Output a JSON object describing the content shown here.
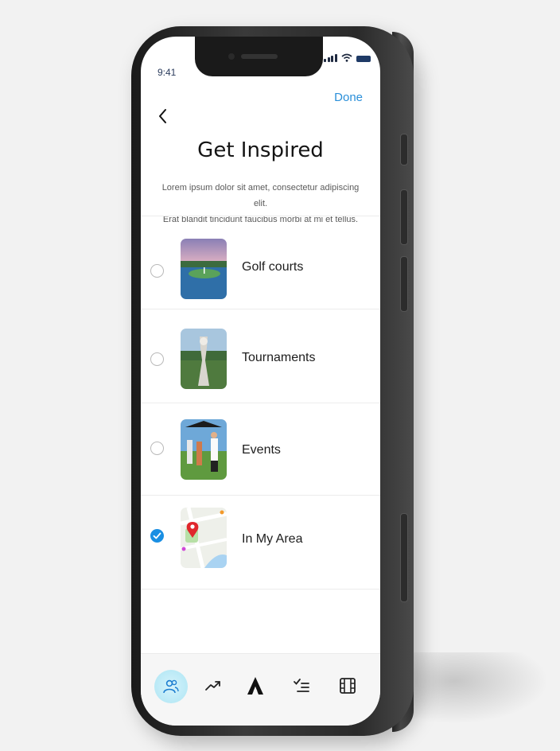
{
  "status": {
    "time": "9:41"
  },
  "header": {
    "done_label": "Done",
    "back_icon": "chevron-left-icon"
  },
  "page": {
    "title": "Get Inspired",
    "description_line1": "Lorem ipsum dolor sit amet, consectetur adipiscing elit.",
    "description_line2": "Erat blandit tincidunt faucibus morbi at mi et tellus."
  },
  "options": [
    {
      "label": "Golf courts",
      "selected": false,
      "image": "golf-course-photo"
    },
    {
      "label": "Tournaments",
      "selected": false,
      "image": "trophy-photo"
    },
    {
      "label": "Events",
      "selected": false,
      "image": "golf-event-photo"
    },
    {
      "label": "In My Area",
      "selected": true,
      "image": "map-pin-illustration"
    }
  ],
  "tabbar": {
    "items": [
      {
        "icon": "people-icon",
        "active": true
      },
      {
        "icon": "trending-up-icon",
        "active": false
      },
      {
        "icon": "app-logo-icon",
        "active": false
      },
      {
        "icon": "checklist-icon",
        "active": false
      },
      {
        "icon": "film-icon",
        "active": false
      }
    ]
  },
  "colors": {
    "accent": "#1a8fe3",
    "done": "#2a8fd9",
    "active_tab": "#b9e9f6"
  }
}
